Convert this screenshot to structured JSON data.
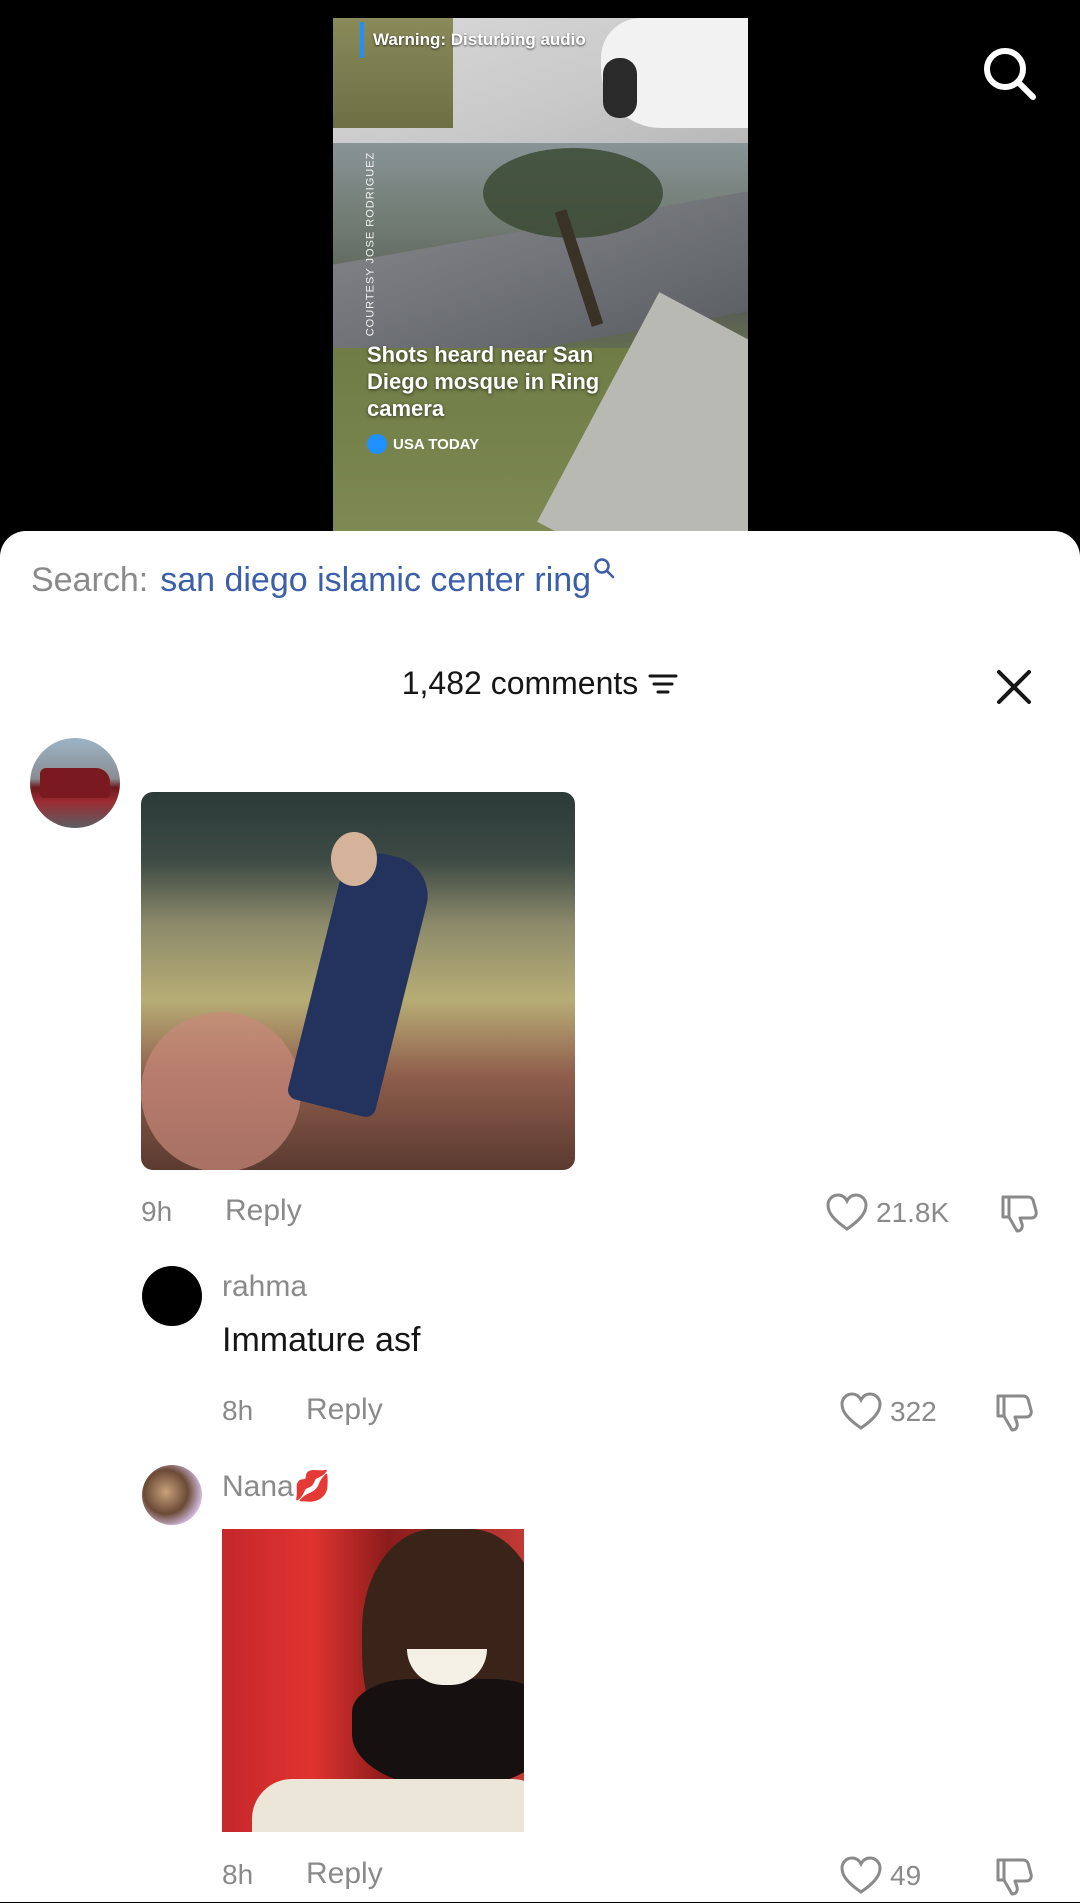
{
  "video": {
    "warning": "Warning: Disturbing audio",
    "courtesy": "COURTESY JOSE RODRIGUEZ",
    "headline": "Shots heard near San Diego mosque in Ring camera",
    "source": "USA TODAY"
  },
  "search": {
    "label": "Search:",
    "query": "san diego islamic center ring"
  },
  "comments_header": {
    "count_label": "1,482 comments"
  },
  "comments": [
    {
      "username": "",
      "text": "",
      "time": "9h",
      "reply_label": "Reply",
      "likes": "21.8K"
    },
    {
      "username": "rahma",
      "text": "Immature asf",
      "time": "8h",
      "reply_label": "Reply",
      "likes": "322"
    },
    {
      "username": "Nana💋",
      "text": "",
      "time": "8h",
      "reply_label": "Reply",
      "likes": "49"
    }
  ],
  "icons": {
    "top_search": "search-icon",
    "close": "close-icon",
    "filter": "filter-icon",
    "like": "heart-icon",
    "dislike": "thumbs-down-icon"
  },
  "colors": {
    "search_query": "#3b5fa8",
    "meta_gray": "#8a8a8a",
    "text_dark": "#161616",
    "warning_accent": "#1e90ff"
  }
}
